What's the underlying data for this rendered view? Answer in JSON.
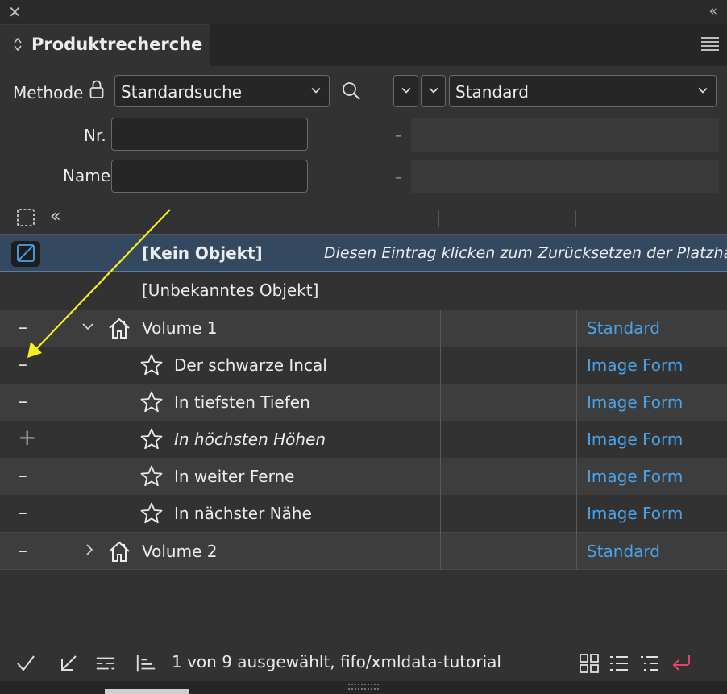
{
  "window": {
    "close_icon": "close-icon",
    "collapse_label": "«"
  },
  "tab": {
    "title": "Produktrecherche"
  },
  "search": {
    "method_label": "Methode",
    "method_value": "Standardsuche",
    "view_value": "Standard",
    "nr_label": "Nr.",
    "name_label": "Name",
    "range_sep": "–",
    "nr_value": "",
    "name_value": ""
  },
  "list": {
    "rows": [
      {
        "name": "[Kein Objekt]",
        "hint": "Diesen Eintrag klicken zum Zurücksetzen der Platzha",
        "form": ""
      },
      {
        "name": "[Unbekanntes Objekt]",
        "form": ""
      },
      {
        "toggle": "–",
        "name": "Volume 1",
        "form": "Standard",
        "icon": "house-icon"
      },
      {
        "toggle": "–",
        "name": "Der schwarze Incal",
        "form": "Image Form",
        "icon": "star-icon"
      },
      {
        "toggle": "–",
        "name": "In tiefsten Tiefen",
        "form": "Image Form",
        "icon": "star-icon"
      },
      {
        "toggle": "+",
        "name": "In höchsten Höhen",
        "form": "Image Form",
        "icon": "star-icon"
      },
      {
        "toggle": "–",
        "name": "In weiter Ferne",
        "form": "Image Form",
        "icon": "star-icon"
      },
      {
        "toggle": "–",
        "name": "In nächster Nähe",
        "form": "Image Form",
        "icon": "star-icon"
      },
      {
        "toggle": "–",
        "name": "Volume 2",
        "form": "Standard",
        "icon": "house-icon"
      }
    ]
  },
  "status": {
    "text": "1 von 9 ausgewählt, fifo/xmldata-tutorial"
  },
  "colors": {
    "link": "#4aa3e8",
    "selected_row": "#34495f",
    "annotation_arrow": "#f5f01e",
    "accent_return": "#e0436e"
  }
}
